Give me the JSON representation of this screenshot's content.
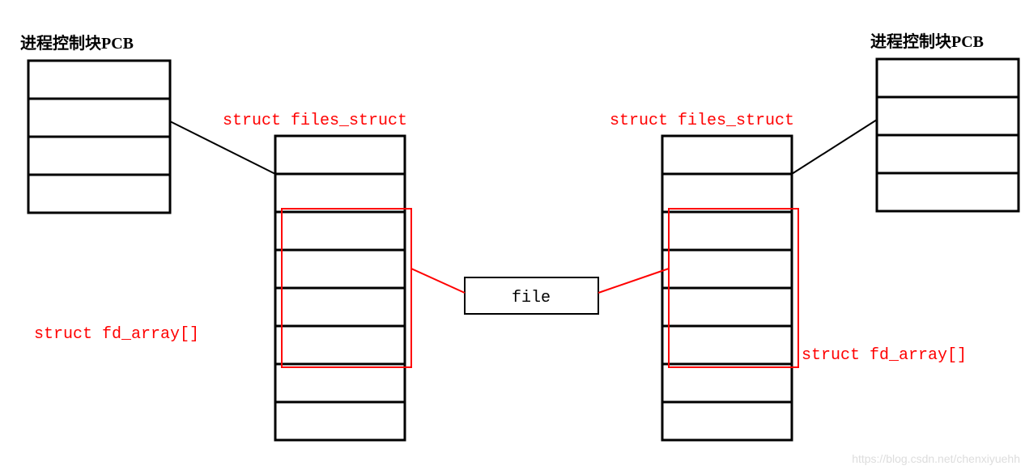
{
  "labels": {
    "pcb_left": "进程控制块PCB",
    "pcb_right": "进程控制块PCB",
    "files_struct_left": "struct files_struct",
    "files_struct_right": "struct files_struct",
    "fd_array_left": "struct fd_array[]",
    "fd_array_right": "struct fd_array[]",
    "file_box": "file"
  },
  "watermark": "https://blog.csdn.net/chenxiyuehh",
  "chart_data": {
    "type": "diagram",
    "title": "Two PCBs sharing one file via files_struct fd_array",
    "nodes": [
      {
        "id": "pcb_left",
        "label": "进程控制块PCB",
        "rows": 4
      },
      {
        "id": "pcb_right",
        "label": "进程控制块PCB",
        "rows": 4
      },
      {
        "id": "files_left",
        "label": "struct files_struct",
        "rows": 8,
        "highlight_rows": [
          2,
          3,
          4,
          5
        ],
        "highlight_label": "struct fd_array[]"
      },
      {
        "id": "files_right",
        "label": "struct files_struct",
        "rows": 8,
        "highlight_rows": [
          2,
          3,
          4,
          5
        ],
        "highlight_label": "struct fd_array[]"
      },
      {
        "id": "file",
        "label": "file"
      }
    ],
    "edges": [
      {
        "from": "pcb_left",
        "to": "files_left",
        "color": "black"
      },
      {
        "from": "pcb_right",
        "to": "files_right",
        "color": "black"
      },
      {
        "from": "files_left",
        "to": "file",
        "color": "red"
      },
      {
        "from": "files_right",
        "to": "file",
        "color": "red"
      }
    ]
  }
}
